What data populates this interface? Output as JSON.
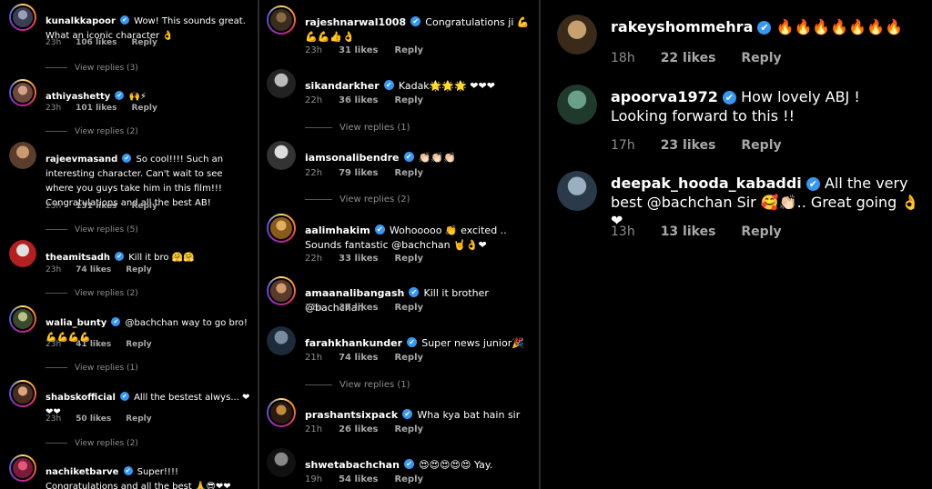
{
  "col1": [
    {
      "user": "kunalkkapoor",
      "text": "Wow! This sounds great. What an iconic character 👌",
      "time": "23h",
      "likes": "106 likes",
      "reply": "Reply",
      "view": "View replies (3)",
      "av": [
        "#3a3f55",
        "#9aa0b8"
      ]
    },
    {
      "user": "athiyashetty",
      "text": "🙌⚡",
      "time": "23h",
      "likes": "101 likes",
      "reply": "Reply",
      "view": "View replies (2)",
      "av": [
        "#6b4a3c",
        "#d2a38a"
      ]
    },
    {
      "user": "rajeevmasand",
      "text": "So cool!!!! Such an interesting character. Can't wait to see where you guys take him in this film!!! Congratulations and all the best AB!",
      "time": "23h",
      "likes": "131 likes",
      "reply": "Reply",
      "view": "View replies (5)",
      "av": [
        "#5a3d2b",
        "#c89a70"
      ]
    },
    {
      "user": "theamitsadh",
      "text": "Kill it bro 🤗🤗",
      "time": "23h",
      "likes": "74 likes",
      "reply": "Reply",
      "view": "View replies (2)",
      "av": [
        "#b32020",
        "#e0e0e0"
      ]
    },
    {
      "user": "walia_bunty",
      "text": "@bachchan way to go bro!💪💪💪💪",
      "time": "23h",
      "likes": "41 likes",
      "reply": "Reply",
      "view": "View replies (1)",
      "av": [
        "#3b4a2a",
        "#b9c08a"
      ]
    },
    {
      "user": "shabskofficial",
      "text": "Alll the bestest alwys... ❤❤❤",
      "time": "23h",
      "likes": "50 likes",
      "reply": "Reply",
      "view": "View replies (2)",
      "av": [
        "#4a2d22",
        "#d9a47e"
      ]
    },
    {
      "user": "nachiketbarve",
      "text": "Super!!!! Congratulations and all the best 🙏😎❤❤ @bachchan",
      "av": [
        "#7a1b3a",
        "#e05a7a"
      ]
    }
  ],
  "col2": [
    {
      "user": "rajeshnarwal1008",
      "text": "Congratulations ji 💪💪💪👍👌",
      "time": "23h",
      "likes": "31 likes",
      "reply": "Reply",
      "av": [
        "#3a2c1e",
        "#8a6a44"
      ]
    },
    {
      "user": "sikandarkher",
      "text": "Kadak🌟🌟🌟 ❤❤❤",
      "time": "22h",
      "likes": "36 likes",
      "reply": "Reply",
      "view": "View replies (1)",
      "av": [
        "#222",
        "#bbb"
      ]
    },
    {
      "user": "iamsonalibendre",
      "text": "👏🏻👏🏻👏🏻",
      "time": "22h",
      "likes": "79 likes",
      "reply": "Reply",
      "view": "View replies (2)",
      "av": [
        "#333",
        "#ddd"
      ]
    },
    {
      "user": "aalimhakim",
      "text": "Wohooooo 👏 excited .. Sounds fantastic @bachchan 🤘👌❤",
      "time": "22h",
      "likes": "33 likes",
      "reply": "Reply",
      "av": [
        "#8a5a1c",
        "#e0b060"
      ]
    },
    {
      "user": "amaanalibangash",
      "text": "Kill it brother @bachchan",
      "time": "22h",
      "likes": "37 likes",
      "reply": "Reply",
      "av": [
        "#5a3a2a",
        "#d49a70"
      ]
    },
    {
      "user": "farahkhankunder",
      "text": "Super news junior🎉",
      "time": "21h",
      "likes": "74 likes",
      "reply": "Reply",
      "view": "View replies (1)",
      "av": [
        "#1c2a3a",
        "#7a8aa0"
      ]
    },
    {
      "user": "prashantsixpack",
      "text": "Wha kya bat hain sir",
      "time": "21h",
      "likes": "26 likes",
      "reply": "Reply",
      "av": [
        "#2a1a10",
        "#c08a40"
      ]
    },
    {
      "user": "shwetabachchan",
      "text": "😍😍😍😍😍 Yay.",
      "time": "19h",
      "likes": "54 likes",
      "reply": "Reply",
      "av": [
        "#111",
        "#888"
      ]
    }
  ],
  "col3": [
    {
      "user": "rakeyshommehra",
      "text": "🔥🔥🔥🔥🔥🔥🔥",
      "time": "18h",
      "likes": "22 likes",
      "reply": "Reply",
      "av": [
        "#3a2a1a",
        "#c8a070"
      ]
    },
    {
      "user": "apoorva1972",
      "text": "How lovely ABJ ! Looking forward to this !!",
      "time": "17h",
      "likes": "23 likes",
      "reply": "Reply",
      "av": [
        "#1f3a2a",
        "#6aa08a"
      ]
    },
    {
      "user": "deepak_hooda_kabaddi",
      "text": "All the very best @bachchan Sir 🥰👏🏻.. Great going 👌❤",
      "time": "13h",
      "likes": "13 likes",
      "reply": "Reply",
      "av": [
        "#2a3a4a",
        "#9ab0c0"
      ]
    }
  ],
  "icons": {
    "verified": "verified-badge-icon",
    "check": "✔"
  }
}
